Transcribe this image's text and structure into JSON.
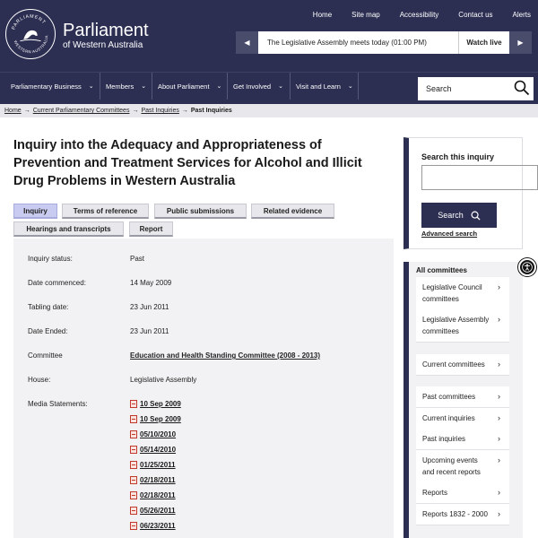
{
  "header": {
    "logo_title": "Parliament",
    "logo_sub": "of Western Australia",
    "seal_text_top": "PARLIAMENT",
    "seal_text_bottom": "WESTERN AUSTRALIA",
    "top_links": [
      "Home",
      "Site map",
      "Accessibility",
      "Contact us",
      "Alerts"
    ],
    "live_text": "The Legislative Assembly meets today (01:00 PM)",
    "watch_label": "Watch live"
  },
  "nav": {
    "items": [
      "Parliamentary Business",
      "Members",
      "About Parliament",
      "Get Involved",
      "Visit and Learn"
    ],
    "search_placeholder": "Search"
  },
  "breadcrumb": {
    "items": [
      "Home",
      "Current Parliamentary Committees",
      "Past Inquiries"
    ],
    "current": "Past Inquiries"
  },
  "page": {
    "title": "Inquiry into the Adequacy and Appropriateness of Prevention and Treatment Services for Alcohol and Illicit Drug Problems in Western Australia",
    "tabs": [
      "Inquiry",
      "Terms of reference",
      "Public submissions",
      "Related evidence",
      "Hearings and transcripts",
      "Report"
    ],
    "details": [
      {
        "label": "Inquiry status:",
        "value": "Past"
      },
      {
        "label": "Date commenced:",
        "value": "14 May 2009"
      },
      {
        "label": "Tabling date:",
        "value": "23 Jun 2011"
      },
      {
        "label": "Date Ended:",
        "value": "23 Jun 2011"
      },
      {
        "label": "Committee",
        "value": "Education and Health Standing Committee (2008 - 2013)"
      },
      {
        "label": "House:",
        "value": "Legislative Assembly"
      }
    ],
    "media_label": "Media Statements:",
    "media": [
      "10 Sep 2009",
      "10 Sep 2009",
      "05/10/2010",
      "05/14/2010",
      "01/25/2011",
      "02/18/2011",
      "02/18/2011",
      "05/26/2011",
      "06/23/2011"
    ]
  },
  "sidebar": {
    "search_label": "Search this inquiry",
    "search_button": "Search",
    "advanced": "Advanced search",
    "committees_head": "All committees",
    "items": [
      {
        "label": "Legislative Council committees"
      },
      {
        "label": "Legislative Assembly committees"
      },
      {
        "label": "Current committees"
      },
      {
        "label": "Past committees"
      },
      {
        "label": "Current inquiries"
      },
      {
        "label": "Past inquiries"
      },
      {
        "label": "Upcoming events and recent reports"
      },
      {
        "label": "Reports"
      },
      {
        "label": "Reports 1832 - 2000"
      }
    ]
  },
  "colors": {
    "primary": "#2c2e52",
    "tab_active": "#c9ccf0",
    "panel": "#f2f2f4"
  }
}
